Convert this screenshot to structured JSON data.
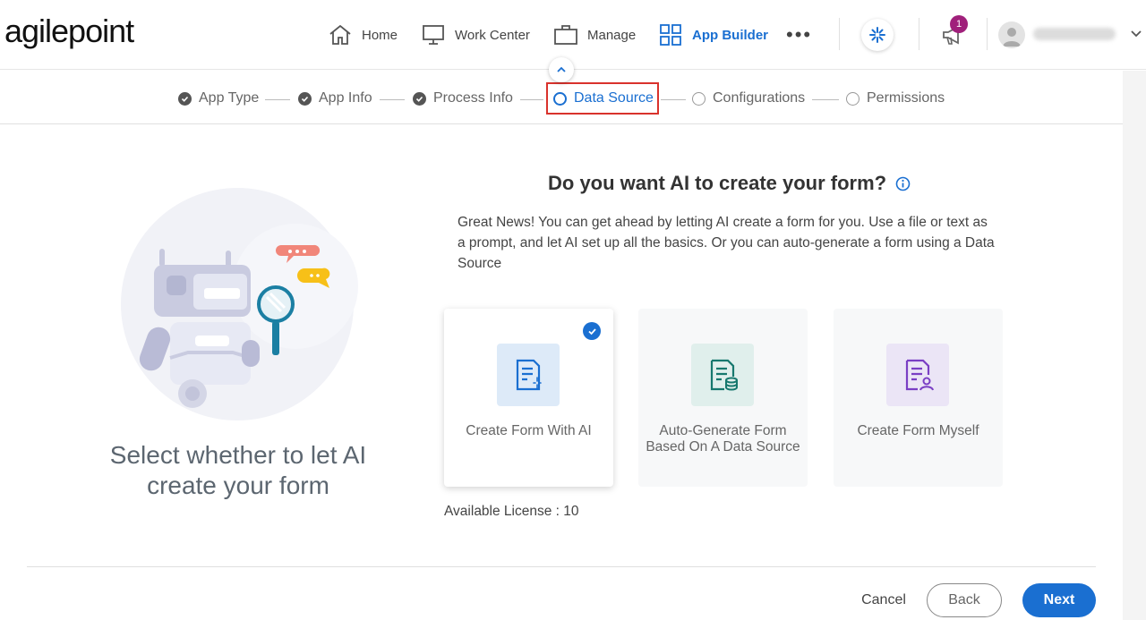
{
  "brand": {
    "logo_text": "agilepoint"
  },
  "nav": {
    "items": [
      {
        "label": "Home",
        "icon": "home-icon"
      },
      {
        "label": "Work Center",
        "icon": "monitor-icon"
      },
      {
        "label": "Manage",
        "icon": "briefcase-icon"
      },
      {
        "label": "App Builder",
        "icon": "grid-icon",
        "active": true
      }
    ],
    "more": "•••",
    "notifications_count": "1"
  },
  "stepper": {
    "steps": [
      {
        "label": "App Type",
        "state": "done"
      },
      {
        "label": "App Info",
        "state": "done"
      },
      {
        "label": "Process Info",
        "state": "done"
      },
      {
        "label": "Data Source",
        "state": "current"
      },
      {
        "label": "Configurations",
        "state": "open"
      },
      {
        "label": "Permissions",
        "state": "open"
      }
    ]
  },
  "hero": {
    "text": "Select whether to let AI create your form"
  },
  "question": {
    "title": "Do you want AI to create your form?",
    "description": "Great News! You can get ahead by letting AI create a form for you. Use a file or text as a prompt, and let AI set up all the basics. Or you can auto-generate a form using a Data Source"
  },
  "cards": [
    {
      "label": "Create Form With AI",
      "selected": true
    },
    {
      "label": "Auto-Generate Form Based On A Data Source",
      "selected": false
    },
    {
      "label": "Create Form Myself",
      "selected": false
    }
  ],
  "license": {
    "text": "Available License : 10"
  },
  "footer": {
    "cancel": "Cancel",
    "back": "Back",
    "next": "Next"
  },
  "colors": {
    "accent": "#1a6fd1",
    "highlight_border": "#d9322c",
    "badge": "#a0207b"
  }
}
